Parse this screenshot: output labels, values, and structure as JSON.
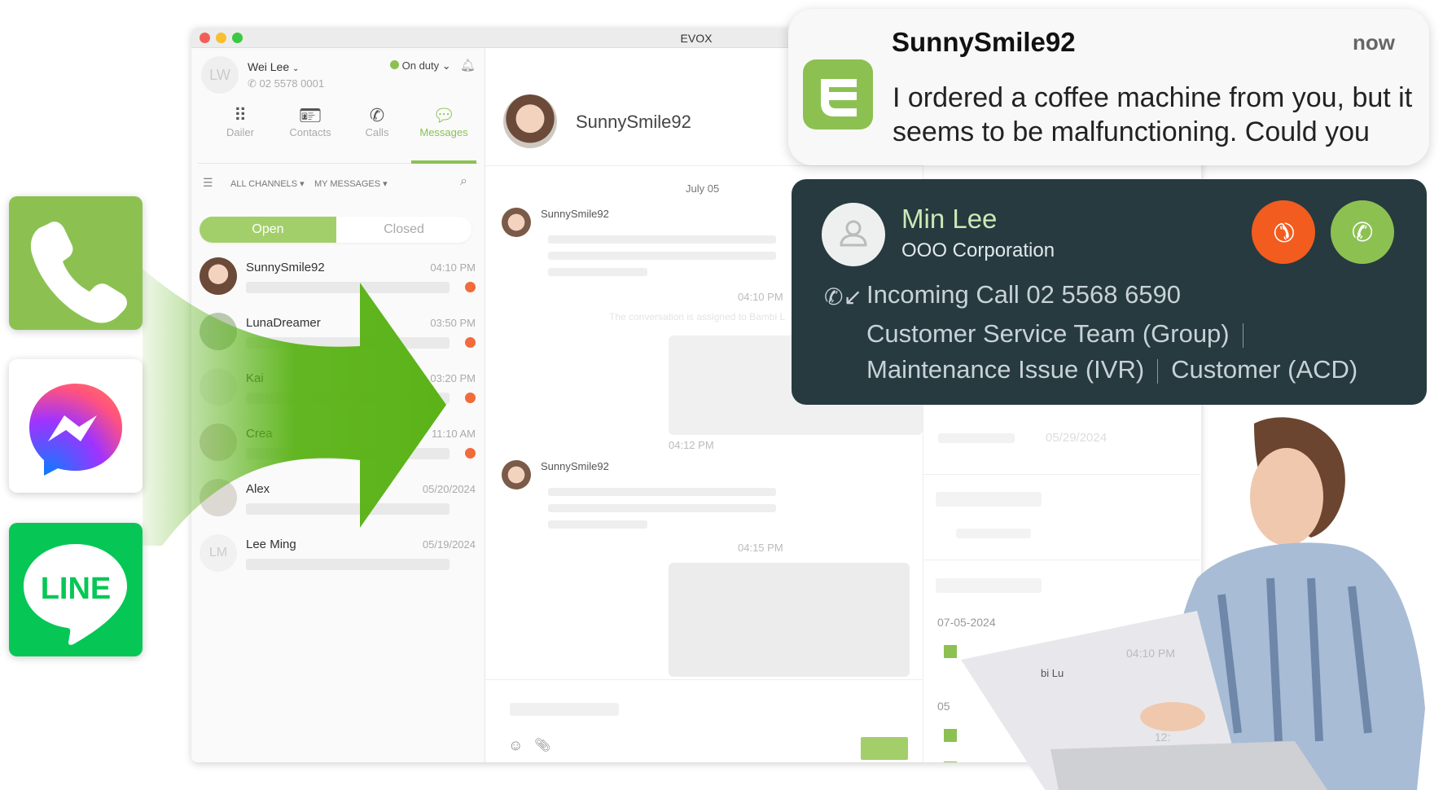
{
  "window": {
    "title": "EVOX"
  },
  "user": {
    "initials": "LW",
    "name": "Wei Lee",
    "phone": "02 5578 0001",
    "status": "On duty",
    "status_color": "#8cc152"
  },
  "nav": [
    {
      "label": "Dailer",
      "icon": "dialpad-icon"
    },
    {
      "label": "Contacts",
      "icon": "contact-card-icon"
    },
    {
      "label": "Calls",
      "icon": "phone-icon"
    },
    {
      "label": "Messages",
      "icon": "message-icon",
      "active": true
    }
  ],
  "filters": {
    "channels": "ALL CHANNELS",
    "messages": "MY MESSAGES"
  },
  "toggle": {
    "open": "Open",
    "closed": "Closed"
  },
  "conversations": [
    {
      "name": "SunnySmile92",
      "time": "04:10 PM",
      "unread": true
    },
    {
      "name": "LunaDreamer",
      "time": "03:50 PM",
      "unread": true
    },
    {
      "name": "Kai",
      "time": "03:20 PM",
      "unread": true
    },
    {
      "name": "Crea",
      "time": "11:10 AM",
      "unread": true
    },
    {
      "name": "Alex",
      "time": "05/20/2024",
      "unread": false
    },
    {
      "name": "Lee Ming",
      "initials": "LM",
      "time": "05/19/2024",
      "unread": false
    }
  ],
  "chat": {
    "contact": "SunnySmile92",
    "date": "July 05",
    "msgs": [
      {
        "sender": "SunnySmile92",
        "time": "04:10 PM"
      },
      {
        "time": "04:12 PM"
      },
      {
        "sender": "SunnySmile92",
        "time": "04:15 PM"
      }
    ],
    "system": "The conversation is assigned to Bambi L"
  },
  "right": {
    "date1": "05/29/2024",
    "date2": "07-05-2024",
    "time1": "04:10 PM",
    "agent": "bi Lu",
    "date3": "05",
    "time2": "12:"
  },
  "notification": {
    "sender": "SunnySmile92",
    "time": "now",
    "text": "I ordered a coffee machine from you, but it seems to be malfunctioning. Could you"
  },
  "call": {
    "name": "Min Lee",
    "company": "OOO Corporation",
    "incoming": "Incoming Call 02 5568 6590",
    "group": "Customer Service Team (Group)",
    "ivr": "Maintenance Issue (IVR)",
    "acd": "Customer (ACD)",
    "decline_color": "#f25c1e",
    "accept_color": "#8cc152"
  },
  "channels": [
    {
      "name": "phone",
      "color": "#8cc152"
    },
    {
      "name": "messenger"
    },
    {
      "name": "LINE",
      "label": "LINE",
      "color": "#06c755"
    }
  ],
  "colors": {
    "accent": "#8cc152",
    "unread": "#f26b3a",
    "arrow": "#5bb318"
  }
}
